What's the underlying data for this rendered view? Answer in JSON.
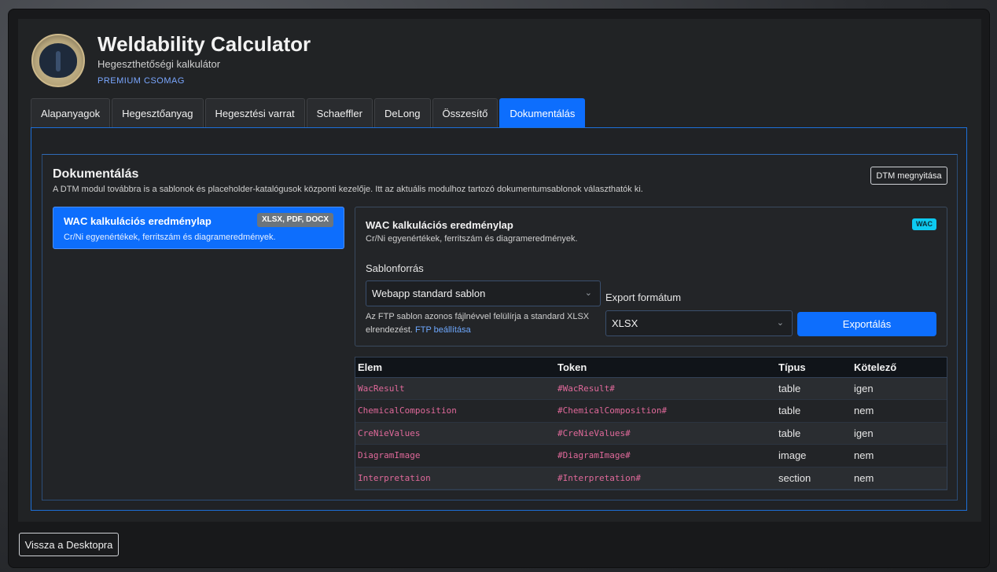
{
  "header": {
    "title": "Weldability Calculator",
    "subtitle": "Hegeszthetőségi kalkulátor",
    "package": "PREMIUM CSOMAG"
  },
  "tabs": [
    {
      "label": "Alapanyagok",
      "active": false
    },
    {
      "label": "Hegesztőanyag",
      "active": false
    },
    {
      "label": "Hegesztési varrat",
      "active": false
    },
    {
      "label": "Schaeffler",
      "active": false
    },
    {
      "label": "DeLong",
      "active": false
    },
    {
      "label": "Összesítő",
      "active": false
    },
    {
      "label": "Dokumentálás",
      "active": true
    }
  ],
  "doc": {
    "title": "Dokumentálás",
    "description": "A DTM modul továbbra is a sablonok és placeholder-katalógusok központi kezelője. Itt az aktuális modulhoz tartozó dokumentumsablonok választhatók ki.",
    "dtm_button": "DTM megnyitása",
    "template_item": {
      "title": "WAC kalkulációs eredménylap",
      "description": "Cr/Ni egyenértékek, ferritszám és diagrameredmények.",
      "formats": "XLSX, PDF, DOCX"
    },
    "detail": {
      "title": "WAC kalkulációs eredménylap",
      "description": "Cr/Ni egyenértékek, ferritszám és diagrameredmények.",
      "badge": "WAC",
      "source_label": "Sablonforrás",
      "source_value": "Webapp standard sablon",
      "hint": "Az FTP sablon azonos fájlnévvel felülírja a standard XLSX elrendezést.",
      "hint_link": "FTP beállítása",
      "export_label": "Export formátum",
      "export_value": "XLSX",
      "export_button": "Exportálás"
    },
    "table": {
      "headers": [
        "Elem",
        "Token",
        "Típus",
        "Kötelező"
      ],
      "rows": [
        [
          "WacResult",
          "#WacResult#",
          "table",
          "igen"
        ],
        [
          "ChemicalComposition",
          "#ChemicalComposition#",
          "table",
          "nem"
        ],
        [
          "CreNieValues",
          "#CreNieValues#",
          "table",
          "igen"
        ],
        [
          "DiagramImage",
          "#DiagramImage#",
          "image",
          "nem"
        ],
        [
          "Interpretation",
          "#Interpretation#",
          "section",
          "nem"
        ]
      ]
    }
  },
  "footer": {
    "back_button": "Vissza a Desktopra"
  }
}
